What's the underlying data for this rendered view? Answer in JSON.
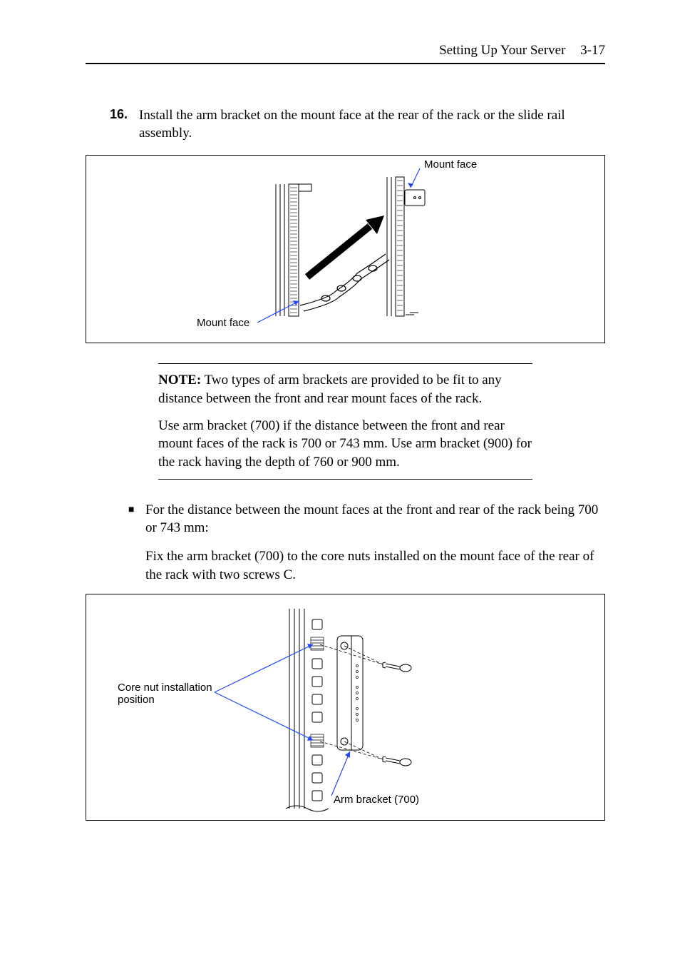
{
  "header": {
    "title": "Setting Up Your Server",
    "page_num": "3-17"
  },
  "step": {
    "number": "16.",
    "text": "Install the arm bracket on the mount face at the rear of the rack or the slide rail assembly."
  },
  "figure1": {
    "label_top": "Mount face",
    "label_bottom": "Mount face"
  },
  "note": {
    "label": "NOTE:",
    "p1_suffix": " Two types of arm brackets are provided to be fit to any distance between the front and rear mount faces of the rack.",
    "p2": "Use arm bracket (700) if the distance between the front and rear mount faces of the rack is 700 or 743 mm. Use arm bracket (900) for the rack having the depth of 760 or 900 mm."
  },
  "bullet": {
    "text": "For the distance between the mount faces at the front and rear of the rack being 700 or 743 mm:"
  },
  "sub_para": "Fix the arm bracket (700) to the core nuts installed on the mount face of the rear of the rack with two screws C.",
  "figure2": {
    "label_left": "Core nut installation position",
    "label_right": "Arm bracket (700)"
  }
}
